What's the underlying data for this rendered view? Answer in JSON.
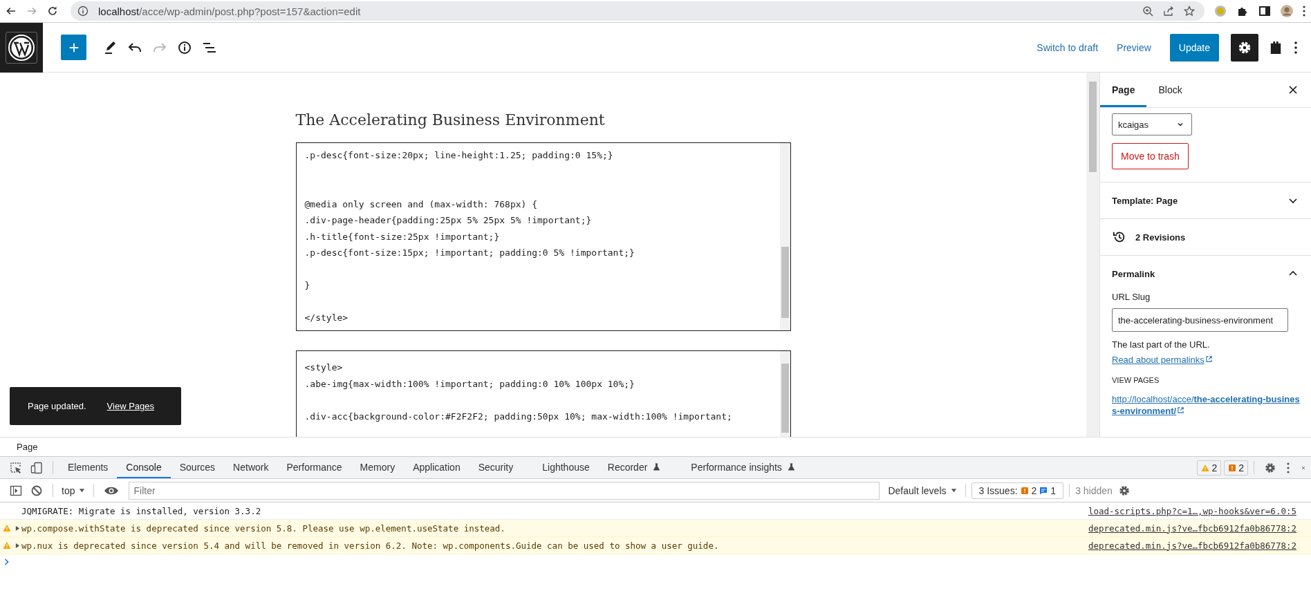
{
  "browser": {
    "nav": [
      {
        "kind": "back",
        "disabled": false
      },
      {
        "kind": "forward",
        "disabled": true
      },
      {
        "kind": "reload",
        "disabled": false
      }
    ],
    "url_host": "localhost",
    "url_path": "/acce/wp-admin/post.php?post=157&action=edit"
  },
  "toolbar": {
    "tools": [
      {
        "kind": "pen",
        "disabled": false
      },
      {
        "kind": "undo",
        "disabled": false
      },
      {
        "kind": "redo",
        "disabled": true
      },
      {
        "kind": "info",
        "disabled": false
      },
      {
        "kind": "list",
        "disabled": false
      }
    ],
    "switch_to_draft": "Switch to draft",
    "preview": "Preview",
    "update": "Update",
    "settings_pressed": true
  },
  "editor": {
    "title": "The Accelerating Business Environment",
    "blocks": [
      {
        "code": ".p-desc{font-size:20px; line-height:1.25; padding:0 15%;}\n\n\n@media only screen and (max-width: 768px) {\n.div-page-header{padding:25px 5% 25px 5% !important;}\n.h-title{font-size:25px !important;}\n.p-desc{font-size:15px; !important; padding:0 5% !important;}\n\n}\n\n</style>"
      },
      {
        "code": "<style>\n.abe-img{max-width:100% !important; padding:0 10% 100px 10%;}\n\n.div-acc{background-color:#F2F2F2; padding:50px 10%; max-width:100% !important;"
      }
    ]
  },
  "notice": {
    "message": "Page updated.",
    "action": "View Pages"
  },
  "sidebar": {
    "tabs": [
      {
        "label": "Page",
        "selected": true
      },
      {
        "label": "Block",
        "selected": false
      }
    ],
    "author": "kcaigas",
    "trash": "Move to trash",
    "template": {
      "title": "Template: Page",
      "expanded": false
    },
    "revisions": "2 Revisions",
    "permalink": {
      "title": "Permalink",
      "expanded": true,
      "slug_label": "URL Slug",
      "slug": "the-accelerating-business-environment",
      "help": "The last part of the URL.",
      "help_link": "Read about permalinks",
      "view_label": "VIEW PAGES",
      "view_link": "http://localhost/acce/**the-accelerating-business-environment/**"
    }
  },
  "breadcrumb": "Page",
  "devtools": {
    "tabs": [
      {
        "label": "Elements",
        "selected": false,
        "experimental": false
      },
      {
        "label": "Console",
        "selected": true,
        "experimental": false
      },
      {
        "label": "Sources",
        "selected": false,
        "experimental": false
      },
      {
        "label": "Network",
        "selected": false,
        "experimental": false
      },
      {
        "label": "Performance",
        "selected": false,
        "experimental": false
      },
      {
        "label": "Memory",
        "selected": false,
        "experimental": false
      },
      {
        "label": "Application",
        "selected": false,
        "experimental": false
      },
      {
        "label": "Security",
        "selected": false,
        "experimental": false
      },
      {
        "label": "Lighthouse",
        "selected": false,
        "experimental": false
      },
      {
        "label": "Recorder",
        "selected": false,
        "experimental": true
      },
      {
        "label": "Performance insights",
        "selected": false,
        "experimental": true
      }
    ],
    "warnings": "2",
    "issues_badge": "2",
    "context": "top",
    "filter_placeholder": "Filter",
    "levels": "Default levels",
    "issues_label": "3 Issues:",
    "issues_warn": "2",
    "issues_info": "1",
    "hidden": "3 hidden",
    "messages": [
      {
        "kind": "info",
        "text": "JQMIGRATE: Migrate is installed, version 3.3.2",
        "source": "load-scripts.php?c=1…,wp-hooks&ver=6.0:5"
      },
      {
        "kind": "warning",
        "text": "wp.compose.withState is deprecated since version 5.8. Please use wp.element.useState instead.",
        "source": "deprecated.min.js?ve…fbcb6912fa0b86778:2"
      },
      {
        "kind": "warning",
        "text": "wp.nux is deprecated since version 5.4 and will be removed in version 6.2. Note: wp.components.Guide can be used to show a user guide.",
        "source": "deprecated.min.js?ve…fbcb6912fa0b86778:2"
      }
    ]
  }
}
